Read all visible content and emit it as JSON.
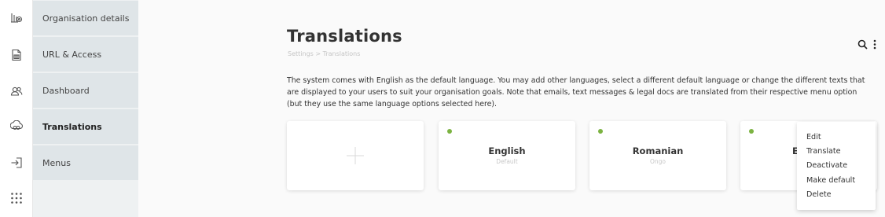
{
  "submenu": {
    "items": [
      {
        "label": "Organisation details"
      },
      {
        "label": "URL & Access"
      },
      {
        "label": "Dashboard"
      },
      {
        "label": "Translations"
      },
      {
        "label": "Menus"
      }
    ]
  },
  "page": {
    "title": "Translations",
    "breadcrumb": "Settings > Translations",
    "description": "The system comes with English as the default language. You may add other languages, select a different default language or change the different texts that are displayed to your users to suit your organisation goals. Note that emails, text messages & legal docs are translated from their respective menu option (but they use the same language options selected here)."
  },
  "cards": [
    {
      "name": "English",
      "subtitle": "Default"
    },
    {
      "name": "Romanian",
      "subtitle": "Ongo"
    },
    {
      "name": "E"
    }
  ],
  "context_menu": {
    "items": [
      "Edit",
      "Translate",
      "Deactivate",
      "Make default",
      "Delete"
    ]
  },
  "icons": {
    "rail": [
      "organisation-icon",
      "url-access-icon",
      "dashboard-users-icon",
      "translations-icon",
      "menus-login-icon",
      "apps-grid-icon"
    ],
    "actions": [
      "search-icon",
      "more-vertical-icon"
    ]
  },
  "colors": {
    "active_dot": "#7cb342",
    "submenu_bg": "#eef1f2",
    "submenu_item_bg": "#dfe5e8"
  }
}
